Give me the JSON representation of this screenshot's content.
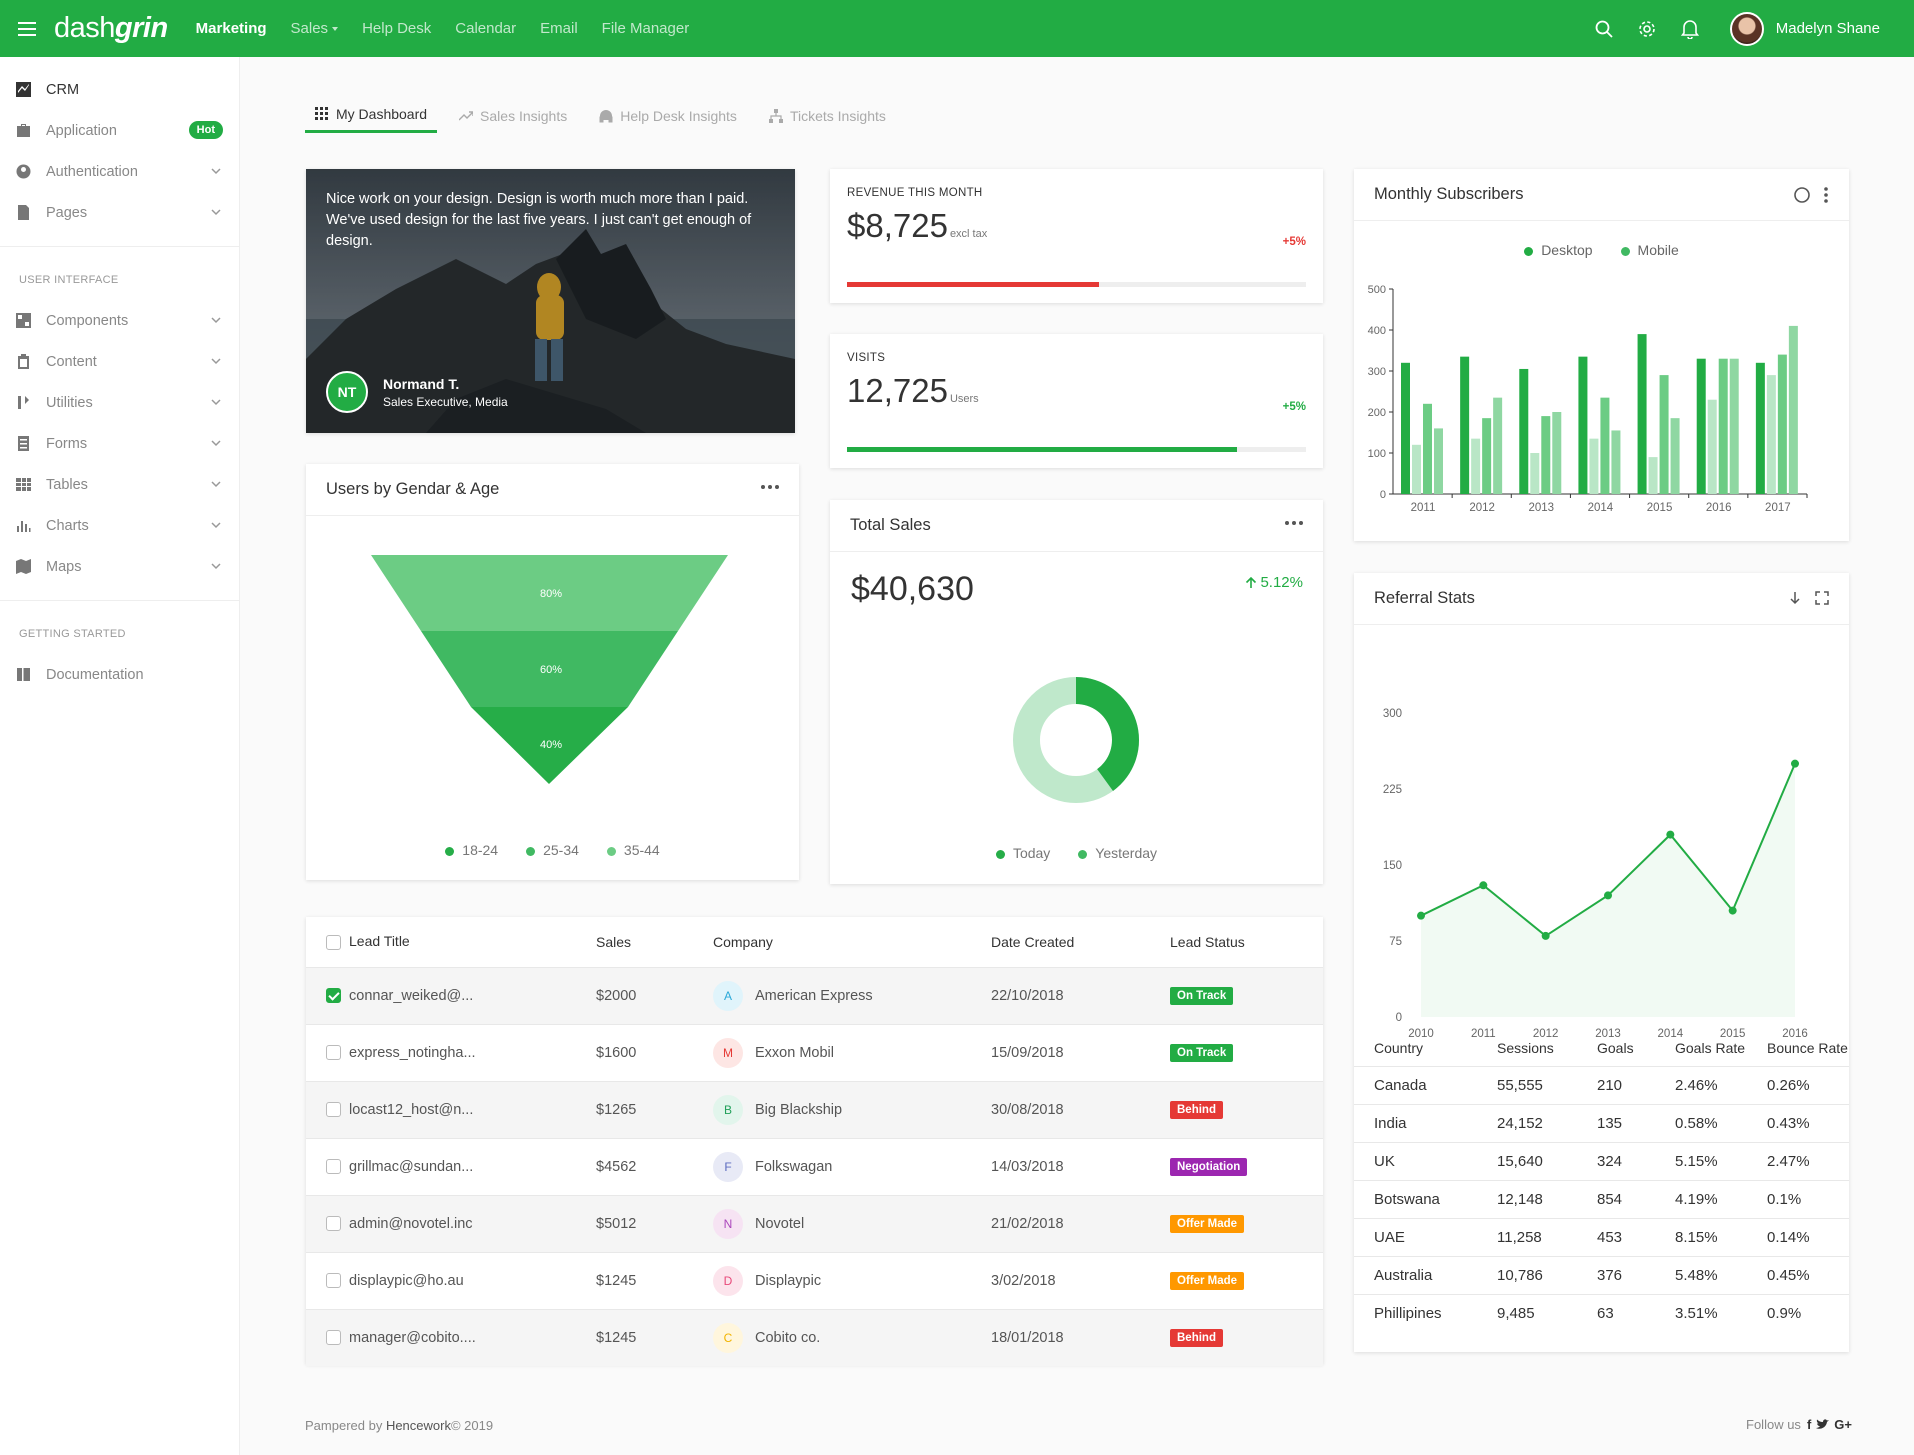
{
  "brand": {
    "regular": "dash",
    "bold": "grin"
  },
  "topnav": [
    {
      "label": "Marketing"
    },
    {
      "label": "Sales"
    },
    {
      "label": "Help Desk"
    },
    {
      "label": "Calendar"
    },
    {
      "label": "Email"
    },
    {
      "label": "File Manager"
    }
  ],
  "user": {
    "name": "Madelyn Shane"
  },
  "sidebar": {
    "items": [
      {
        "label": "CRM",
        "icon": "chart-icon"
      },
      {
        "label": "Application",
        "icon": "briefcase-icon",
        "badge": "Hot"
      },
      {
        "label": "Authentication",
        "icon": "user-icon"
      },
      {
        "label": "Pages",
        "icon": "page-icon"
      }
    ],
    "ui_heading": "USER INTERFACE",
    "ui_items": [
      {
        "label": "Components",
        "icon": "components-icon"
      },
      {
        "label": "Content",
        "icon": "clipboard-icon"
      },
      {
        "label": "Utilities",
        "icon": "utilities-icon"
      },
      {
        "label": "Forms",
        "icon": "form-icon"
      },
      {
        "label": "Tables",
        "icon": "table-icon"
      },
      {
        "label": "Charts",
        "icon": "bar-chart-icon"
      },
      {
        "label": "Maps",
        "icon": "map-icon"
      }
    ],
    "gs_heading": "GETTING STARTED",
    "gs_items": [
      {
        "label": "Documentation",
        "icon": "book-icon"
      }
    ]
  },
  "tabs": [
    {
      "label": "My Dashboard",
      "icon": "grid-icon"
    },
    {
      "label": "Sales Insights",
      "icon": "trend-icon"
    },
    {
      "label": "Help Desk Insights",
      "icon": "headphones-icon"
    },
    {
      "label": "Tickets Insights",
      "icon": "sitemap-icon"
    }
  ],
  "hero": {
    "quote": "Nice work on your design. Design is worth much more than I paid. We've used design for the last five years. I just can't get enough of design.",
    "initials": "NT",
    "name": "Normand T.",
    "role": "Sales Executive, Media"
  },
  "revenue": {
    "label": "REVENUE THIS MONTH",
    "value": "$8,725",
    "unit": "excl tax",
    "change": "+5%",
    "progress": 0.55,
    "color": "#e53935"
  },
  "visits": {
    "label": "VISITS",
    "value": "12,725",
    "unit": "Users",
    "change": "+5%",
    "progress": 0.85,
    "color": "#22ac44"
  },
  "funnel": {
    "title": "Users by Gendar & Age",
    "segments": [
      {
        "label": "80%"
      },
      {
        "label": "60%"
      },
      {
        "label": "40%"
      }
    ],
    "legend": [
      {
        "label": "18-24"
      },
      {
        "label": "25-34"
      },
      {
        "label": "35-44"
      }
    ]
  },
  "total_sales": {
    "title": "Total Sales",
    "value": "$40,630",
    "change": "5.12%",
    "legend": [
      {
        "label": "Today"
      },
      {
        "label": "Yesterday"
      }
    ],
    "today_share": 0.4
  },
  "subscribers": {
    "title": "Monthly Subscribers",
    "legend": [
      {
        "label": "Desktop"
      },
      {
        "label": "Mobile"
      }
    ]
  },
  "referral": {
    "title": "Referral Stats"
  },
  "leads": {
    "headers": {
      "lead": "Lead Title",
      "sales": "Sales",
      "company": "Company",
      "date": "Date Created",
      "status": "Lead Status"
    },
    "rows": [
      {
        "lead": "connar_weiked@...",
        "sales": "$2000",
        "initial": "A",
        "company": "American Express",
        "date": "22/10/2018",
        "status": "On Track",
        "checked": true
      },
      {
        "lead": "express_notingha...",
        "sales": "$1600",
        "initial": "M",
        "company": "Exxon Mobil",
        "date": "15/09/2018",
        "status": "On Track",
        "checked": false
      },
      {
        "lead": "locast12_host@n...",
        "sales": "$1265",
        "initial": "B",
        "company": "Big Blackship",
        "date": "30/08/2018",
        "status": "Behind",
        "checked": false
      },
      {
        "lead": "grillmac@sundan...",
        "sales": "$4562",
        "initial": "F",
        "company": "Folkswagan",
        "date": "14/03/2018",
        "status": "Negotiation",
        "checked": false
      },
      {
        "lead": "admin@novotel.inc",
        "sales": "$5012",
        "initial": "N",
        "company": "Novotel",
        "date": "21/02/2018",
        "status": "Offer Made",
        "checked": false
      },
      {
        "lead": "displaypic@ho.au",
        "sales": "$1245",
        "initial": "D",
        "company": "Displaypic",
        "date": "3/02/2018",
        "status": "Offer Made",
        "checked": false
      },
      {
        "lead": "manager@cobito....",
        "sales": "$1245",
        "initial": "C",
        "company": "Cobito co.",
        "date": "18/01/2018",
        "status": "Behind",
        "checked": false
      }
    ],
    "status_colors": {
      "On Track": "#22ac44",
      "Behind": "#e53935",
      "Negotiation": "#9c27b0",
      "Offer Made": "#ff9800"
    },
    "avatar_colors": {
      "A": [
        "#e0f4fb",
        "#2aa8d8"
      ],
      "M": [
        "#fde6e4",
        "#e53935"
      ],
      "B": [
        "#e2f5ec",
        "#22a05a"
      ],
      "F": [
        "#e8eaf6",
        "#5c6bc0"
      ],
      "N": [
        "#f6e3f3",
        "#ab47bc"
      ],
      "D": [
        "#fce4ec",
        "#e84a7a"
      ],
      "C": [
        "#fff6dd",
        "#f2b400"
      ]
    }
  },
  "referral_table": {
    "headers": {
      "country": "Country",
      "sessions": "Sessions",
      "goals": "Goals",
      "goal_rate": "Goals Rate",
      "bounce": "Bounce Rate"
    },
    "rows": [
      {
        "country": "Canada",
        "sessions": "55,555",
        "goals": "210",
        "goal_rate": "2.46%",
        "bounce": "0.26%"
      },
      {
        "country": "India",
        "sessions": "24,152",
        "goals": "135",
        "goal_rate": "0.58%",
        "bounce": "0.43%"
      },
      {
        "country": "UK",
        "sessions": "15,640",
        "goals": "324",
        "goal_rate": "5.15%",
        "bounce": "2.47%"
      },
      {
        "country": "Botswana",
        "sessions": "12,148",
        "goals": "854",
        "goal_rate": "4.19%",
        "bounce": "0.1%"
      },
      {
        "country": "UAE",
        "sessions": "11,258",
        "goals": "453",
        "goal_rate": "8.15%",
        "bounce": "0.14%"
      },
      {
        "country": "Australia",
        "sessions": "10,786",
        "goals": "376",
        "goal_rate": "5.48%",
        "bounce": "0.45%"
      },
      {
        "country": "Phillipines",
        "sessions": "9,485",
        "goals": "63",
        "goal_rate": "3.51%",
        "bounce": "0.9%"
      }
    ]
  },
  "footer": {
    "left_pre": "Pampered by ",
    "left_brand": "Hencework",
    "left_post": "© 2019",
    "follow": "Follow us"
  },
  "colors": {
    "accent": "#22ac44",
    "accent_mid": "#56c474",
    "accent_light": "#a8e2b8",
    "danger": "#e53935"
  },
  "chart_data": [
    {
      "type": "bar",
      "title": "Monthly Subscribers",
      "categories": [
        "2011",
        "2012",
        "2013",
        "2014",
        "2015",
        "2016",
        "2017"
      ],
      "ylim": [
        0,
        500
      ],
      "yticks": [
        0,
        100,
        200,
        300,
        400,
        500
      ],
      "series": [
        {
          "name": "Desktop",
          "values": [
            320,
            335,
            305,
            335,
            390,
            330,
            320
          ]
        },
        {
          "name": "Mobile",
          "values": [
            120,
            135,
            100,
            135,
            90,
            230,
            290
          ]
        },
        {
          "name": "",
          "values": [
            220,
            185,
            190,
            235,
            290,
            330,
            340
          ]
        },
        {
          "name": "",
          "values": [
            160,
            235,
            200,
            155,
            185,
            330,
            410
          ]
        }
      ],
      "legend": "top"
    },
    {
      "type": "area",
      "title": "Referral Stats",
      "x": [
        "2010",
        "2011",
        "2012",
        "2013",
        "2014",
        "2015",
        "2016"
      ],
      "values": [
        100,
        130,
        80,
        120,
        180,
        105,
        250
      ],
      "ylim": [
        0,
        300
      ],
      "yticks": [
        0,
        75,
        150,
        225,
        300
      ]
    }
  ]
}
